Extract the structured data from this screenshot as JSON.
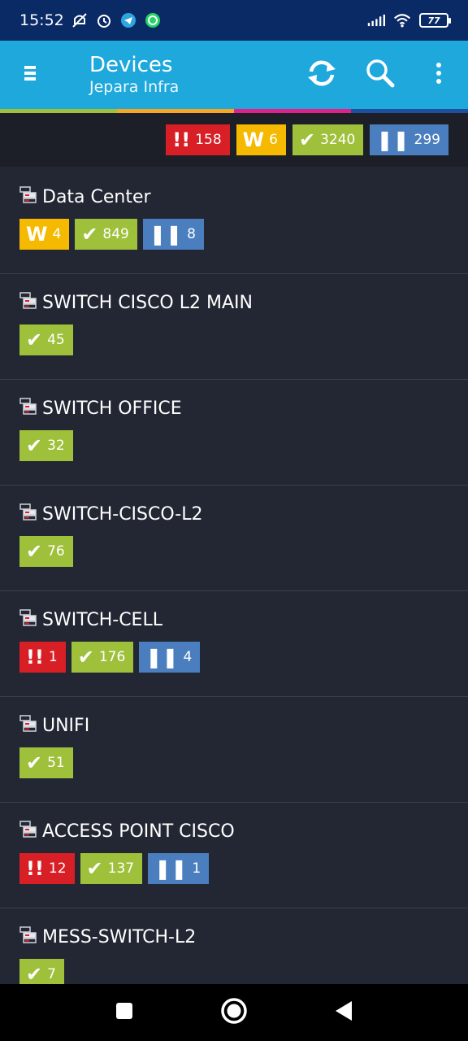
{
  "status": {
    "time": "15:52",
    "battery": "77",
    "icons": [
      "mute-icon",
      "alarm-icon",
      "telegram-icon",
      "whatsapp-icon",
      "signal-icon",
      "wifi-icon",
      "battery-icon"
    ]
  },
  "app_bar": {
    "title": "Devices",
    "subtitle": "Jepara Infra",
    "icons": [
      "menu-icon",
      "refresh-icon",
      "search-icon",
      "more-vert-icon"
    ]
  },
  "accent_colors": [
    "#9fc03b",
    "#f5a623",
    "#e0218a",
    "#1f4e9c"
  ],
  "summary": {
    "red": "158",
    "yellow": "6",
    "green": "3240",
    "blue": "299"
  },
  "devices": [
    {
      "name": "Data Center",
      "badges": [
        {
          "type": "yellow",
          "value": "4"
        },
        {
          "type": "green",
          "value": "849"
        },
        {
          "type": "blue",
          "value": "8"
        }
      ]
    },
    {
      "name": "SWITCH CISCO L2 MAIN",
      "badges": [
        {
          "type": "green",
          "value": "45"
        }
      ]
    },
    {
      "name": "SWITCH OFFICE",
      "badges": [
        {
          "type": "green",
          "value": "32"
        }
      ]
    },
    {
      "name": "SWITCH-CISCO-L2",
      "badges": [
        {
          "type": "green",
          "value": "76"
        }
      ]
    },
    {
      "name": "SWITCH-CELL",
      "badges": [
        {
          "type": "red",
          "value": "1"
        },
        {
          "type": "green",
          "value": "176"
        },
        {
          "type": "blue",
          "value": "4"
        }
      ]
    },
    {
      "name": "UNIFI",
      "badges": [
        {
          "type": "green",
          "value": "51"
        }
      ]
    },
    {
      "name": "ACCESS POINT CISCO",
      "badges": [
        {
          "type": "red",
          "value": "12"
        },
        {
          "type": "green",
          "value": "137"
        },
        {
          "type": "blue",
          "value": "1"
        }
      ]
    },
    {
      "name": "MESS-SWITCH-L2",
      "badges": [
        {
          "type": "green",
          "value": "7"
        }
      ]
    }
  ],
  "colors": {
    "red": "#d81f26",
    "yellow": "#f5b900",
    "green": "#9fc03b",
    "blue": "#4a7ebf",
    "app_bar": "#1ea8dc",
    "status_bar": "#0a2a66",
    "background": "#232733"
  }
}
